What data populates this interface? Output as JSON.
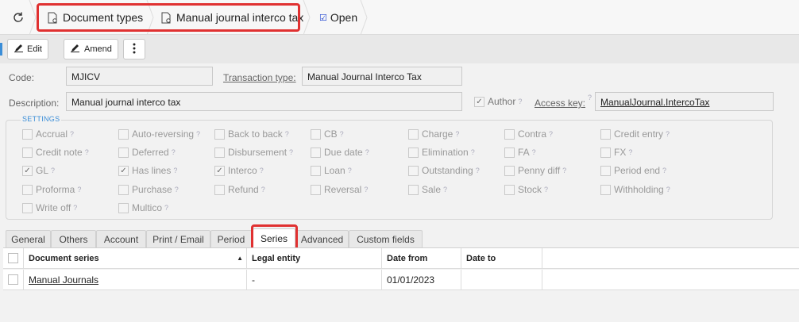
{
  "breadcrumbs": [
    {
      "label": "Document types"
    },
    {
      "label": "Manual journal interco tax"
    },
    {
      "label": "Open"
    }
  ],
  "toolbar": {
    "edit_label": "Edit",
    "amend_label": "Amend"
  },
  "form": {
    "code_label": "Code:",
    "code_value": "MJICV",
    "transaction_type_label": "Transaction type:",
    "transaction_type_value": "Manual Journal Interco Tax",
    "description_label": "Description:",
    "description_value": "Manual journal interco tax",
    "author_label": "Author",
    "access_key_label": "Access key:",
    "access_key_value": "ManualJournal.IntercoTax"
  },
  "settings": {
    "title": "SETTINGS",
    "items": [
      {
        "label": "Accrual",
        "checked": false
      },
      {
        "label": "Auto-reversing",
        "checked": false
      },
      {
        "label": "Back to back",
        "checked": false
      },
      {
        "label": "CB",
        "checked": false
      },
      {
        "label": "Charge",
        "checked": false
      },
      {
        "label": "Contra",
        "checked": false
      },
      {
        "label": "Credit entry",
        "checked": false
      },
      {
        "label": "Credit note",
        "checked": false
      },
      {
        "label": "Deferred",
        "checked": false
      },
      {
        "label": "Disbursement",
        "checked": false
      },
      {
        "label": "Due date",
        "checked": false
      },
      {
        "label": "Elimination",
        "checked": false
      },
      {
        "label": "FA",
        "checked": false
      },
      {
        "label": "FX",
        "checked": false
      },
      {
        "label": "GL",
        "checked": true
      },
      {
        "label": "Has lines",
        "checked": true
      },
      {
        "label": "Interco",
        "checked": true
      },
      {
        "label": "Loan",
        "checked": false
      },
      {
        "label": "Outstanding",
        "checked": false
      },
      {
        "label": "Penny diff",
        "checked": false
      },
      {
        "label": "Period end",
        "checked": false
      },
      {
        "label": "Proforma",
        "checked": false
      },
      {
        "label": "Purchase",
        "checked": false
      },
      {
        "label": "Refund",
        "checked": false
      },
      {
        "label": "Reversal",
        "checked": false
      },
      {
        "label": "Sale",
        "checked": false
      },
      {
        "label": "Stock",
        "checked": false
      },
      {
        "label": "Withholding",
        "checked": false
      },
      {
        "label": "Write off",
        "checked": false
      },
      {
        "label": "Multico",
        "checked": false
      }
    ]
  },
  "tabs": [
    {
      "label": "General"
    },
    {
      "label": "Others"
    },
    {
      "label": "Account"
    },
    {
      "label": "Print / Email"
    },
    {
      "label": "Period"
    },
    {
      "label": "Series",
      "active": true
    },
    {
      "label": "Advanced"
    },
    {
      "label": "Custom fields"
    }
  ],
  "grid": {
    "columns": [
      "Document series",
      "Legal entity",
      "Date from",
      "Date to"
    ],
    "sort_indicator": "▲",
    "rows": [
      {
        "document_series": "Manual Journals",
        "legal_entity": "-",
        "date_from": "01/01/2023",
        "date_to": ""
      }
    ]
  },
  "colors": {
    "highlight": "#e03131",
    "accent": "#3b8ed8"
  }
}
